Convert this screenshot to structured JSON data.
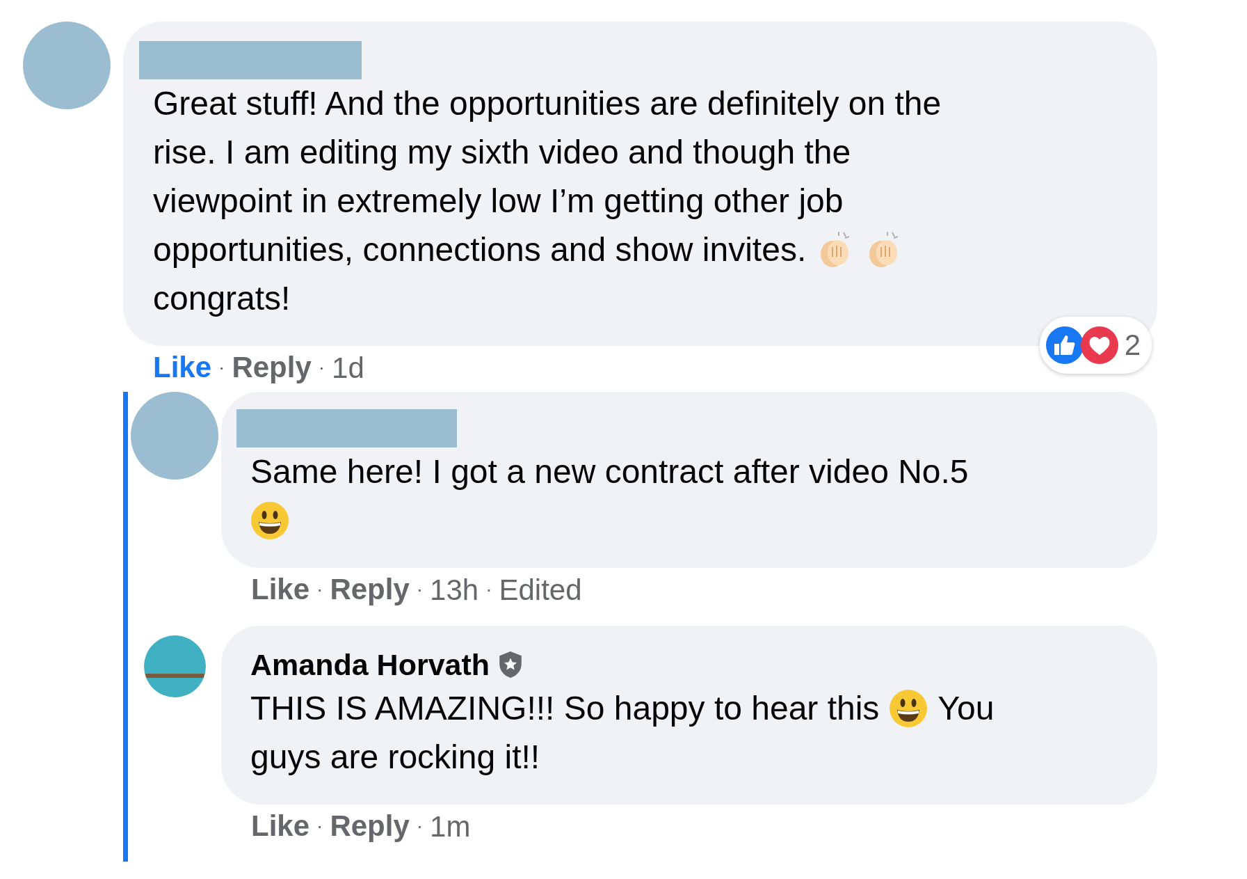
{
  "comments": [
    {
      "body": [
        [
          {
            "kind": "text",
            "text": "Great stuff! And the opportunities are definitely on the"
          }
        ],
        [
          {
            "kind": "text",
            "text": "rise. I am editing my sixth video and though the"
          }
        ],
        [
          {
            "kind": "text",
            "text": "viewpoint in extremely low I’m getting other job"
          }
        ],
        [
          {
            "kind": "text",
            "text": "opportunities, connections and show invites."
          },
          {
            "kind": "clap"
          },
          {
            "kind": "clap"
          }
        ],
        [
          {
            "kind": "text",
            "text": "congrats!"
          }
        ]
      ],
      "meta": [
        {
          "kind": "action",
          "label": "Like",
          "selected": true
        },
        {
          "kind": "sep",
          "text": "·"
        },
        {
          "kind": "action",
          "label": "Reply",
          "selected": false
        },
        {
          "kind": "sep",
          "text": "·"
        },
        {
          "kind": "time",
          "text": "1d"
        }
      ],
      "reactions": {
        "icons": [
          {
            "kind": "like"
          },
          {
            "kind": "love"
          }
        ],
        "count": "2"
      },
      "replies": [
        {
          "body": [
            [
              {
                "kind": "text",
                "text": "Same here! I got a new contract after video No.5"
              }
            ],
            [
              {
                "kind": "grin"
              }
            ]
          ],
          "meta": [
            {
              "kind": "action",
              "label": "Like",
              "selected": false
            },
            {
              "kind": "sep",
              "text": "·"
            },
            {
              "kind": "action",
              "label": "Reply",
              "selected": false
            },
            {
              "kind": "sep",
              "text": "·"
            },
            {
              "kind": "time",
              "text": "13h"
            },
            {
              "kind": "sep",
              "text": "·"
            },
            {
              "kind": "edited",
              "text": "Edited"
            }
          ]
        },
        {
          "author": "Amanda Horvath",
          "verified": true,
          "avatar_photo": true,
          "body": [
            [
              {
                "kind": "text",
                "text": "THIS IS AMAZING!!! So happy to hear this"
              },
              {
                "kind": "grin"
              },
              {
                "kind": "text",
                "text": "You"
              }
            ],
            [
              {
                "kind": "text",
                "text": "guys are rocking it!!"
              }
            ]
          ],
          "meta": [
            {
              "kind": "action",
              "label": "Like",
              "selected": false
            },
            {
              "kind": "sep",
              "text": "·"
            },
            {
              "kind": "action",
              "label": "Reply",
              "selected": false
            },
            {
              "kind": "sep",
              "text": "·"
            },
            {
              "kind": "time",
              "text": "1m"
            }
          ]
        }
      ]
    }
  ]
}
